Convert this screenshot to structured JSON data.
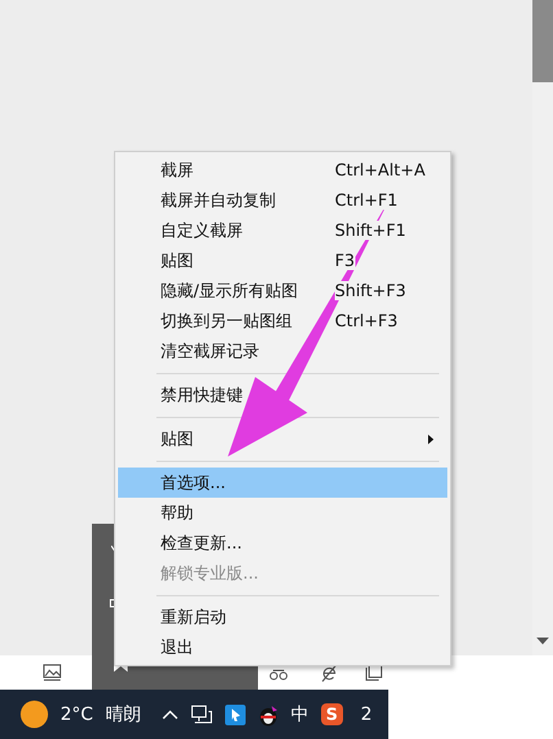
{
  "menu": {
    "sections": [
      [
        {
          "label": "截屏",
          "shortcut": "Ctrl+Alt+A",
          "selected": false,
          "disabled": false,
          "submenu": false
        },
        {
          "label": "截屏并自动复制",
          "shortcut": "Ctrl+F1",
          "selected": false,
          "disabled": false,
          "submenu": false
        },
        {
          "label": "自定义截屏",
          "shortcut": "Shift+F1",
          "selected": false,
          "disabled": false,
          "submenu": false
        },
        {
          "label": "贴图",
          "shortcut": "F3",
          "selected": false,
          "disabled": false,
          "submenu": false
        },
        {
          "label": "隐藏/显示所有贴图",
          "shortcut": "Shift+F3",
          "selected": false,
          "disabled": false,
          "submenu": false
        },
        {
          "label": "切换到另一贴图组",
          "shortcut": "Ctrl+F3",
          "selected": false,
          "disabled": false,
          "submenu": false
        },
        {
          "label": "清空截屏记录",
          "selected": false,
          "disabled": false,
          "submenu": false
        }
      ],
      [
        {
          "label": "禁用快捷键",
          "selected": false,
          "disabled": false,
          "submenu": false
        }
      ],
      [
        {
          "label": "贴图",
          "selected": false,
          "disabled": false,
          "submenu": true
        }
      ],
      [
        {
          "label": "首选项...",
          "selected": true,
          "disabled": false,
          "submenu": false
        },
        {
          "label": "帮助",
          "selected": false,
          "disabled": false,
          "submenu": false
        },
        {
          "label": "检查更新...",
          "selected": false,
          "disabled": false,
          "submenu": false
        },
        {
          "label": "解锁专业版...",
          "selected": false,
          "disabled": true,
          "submenu": false
        }
      ],
      [
        {
          "label": "重新启动",
          "selected": false,
          "disabled": false,
          "submenu": false
        },
        {
          "label": "退出",
          "selected": false,
          "disabled": false,
          "submenu": false
        }
      ]
    ]
  },
  "taskbar": {
    "temperature": "2°C",
    "weather": "晴朗",
    "input_method": "中",
    "ime_logo": "S",
    "clock": "2"
  }
}
